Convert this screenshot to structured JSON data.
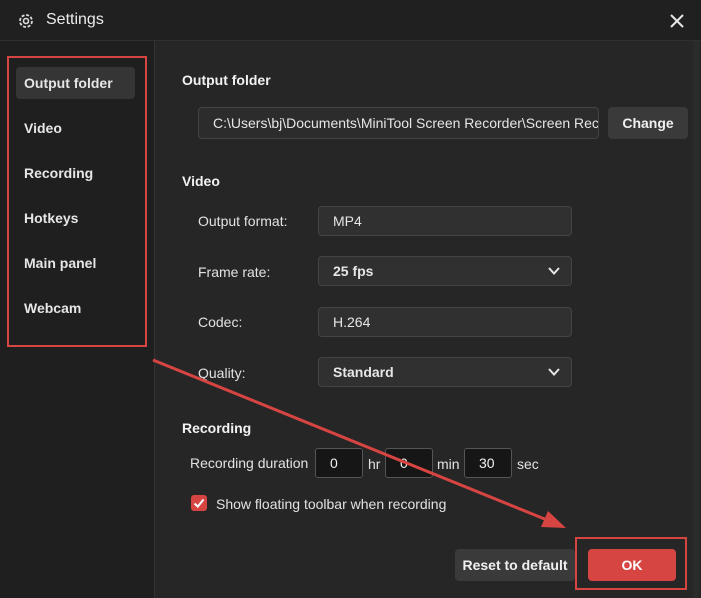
{
  "window": {
    "title": "Settings"
  },
  "sidebar": {
    "items": [
      {
        "label": "Output folder",
        "active": true
      },
      {
        "label": "Video"
      },
      {
        "label": "Recording"
      },
      {
        "label": "Hotkeys"
      },
      {
        "label": "Main panel"
      },
      {
        "label": "Webcam"
      }
    ]
  },
  "output_folder": {
    "title": "Output folder",
    "path": "C:\\Users\\bj\\Documents\\MiniTool Screen Recorder\\Screen Rec",
    "change_label": "Change"
  },
  "video": {
    "title": "Video",
    "output_format_label": "Output format:",
    "output_format_value": "MP4",
    "frame_rate_label": "Frame rate:",
    "frame_rate_value": "25 fps",
    "codec_label": "Codec:",
    "codec_value": "H.264",
    "quality_label": "Quality:",
    "quality_value": "Standard"
  },
  "recording": {
    "title": "Recording",
    "duration_label": "Recording duration",
    "hours": "0",
    "hours_unit": "hr",
    "minutes": "0",
    "minutes_unit": "min",
    "seconds": "30",
    "seconds_unit": "sec",
    "floating_toolbar_label": "Show floating toolbar when recording",
    "floating_toolbar_checked": true
  },
  "footer": {
    "reset_label": "Reset to default",
    "ok_label": "OK"
  },
  "colors": {
    "accent": "#d64541",
    "background": "#262626",
    "sidebar": "#1f1f1f"
  }
}
